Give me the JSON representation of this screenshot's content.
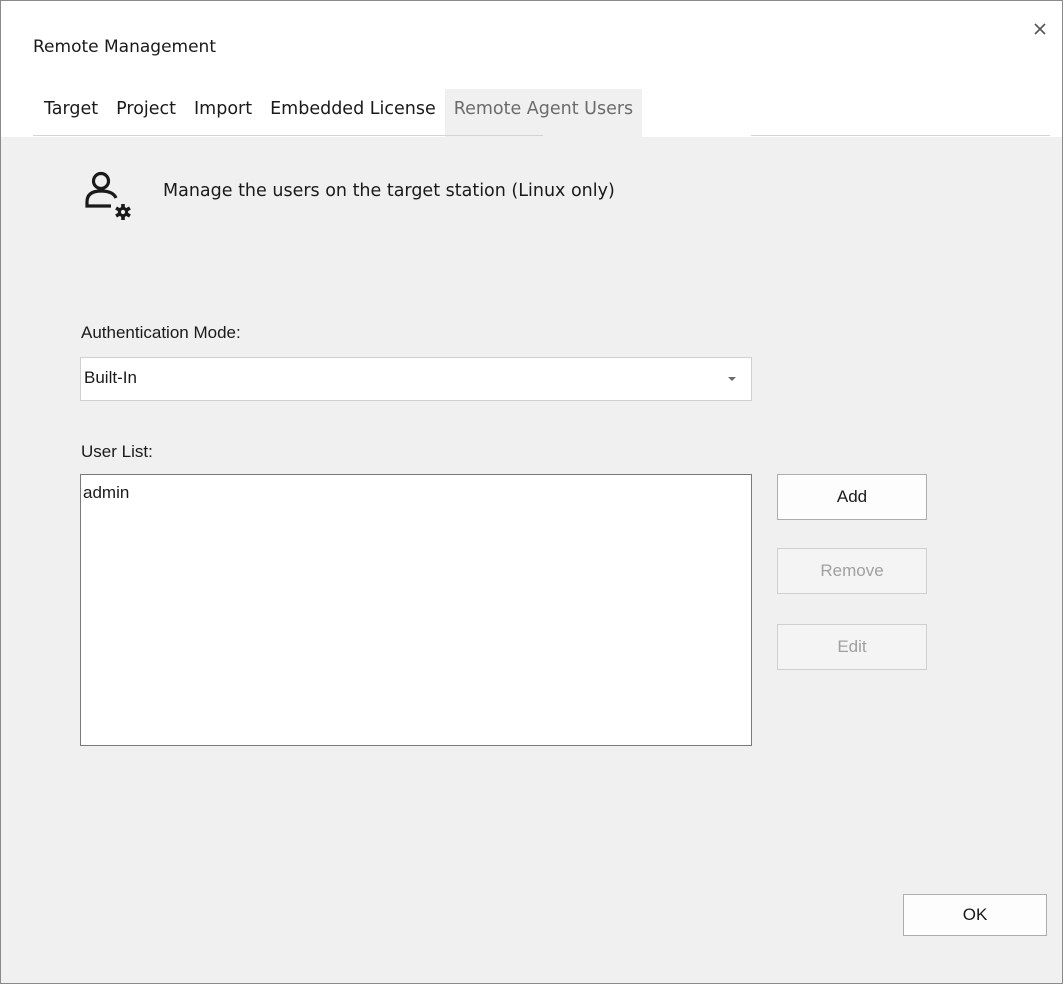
{
  "window": {
    "title": "Remote Management"
  },
  "tabs": [
    {
      "label": "Target"
    },
    {
      "label": "Project"
    },
    {
      "label": "Import"
    },
    {
      "label": "Embedded License"
    },
    {
      "label": "Remote Agent Users",
      "active": true
    }
  ],
  "header": {
    "icon": "user-gear-icon",
    "text": "Manage the users on the target station (Linux only)"
  },
  "auth": {
    "label": "Authentication Mode:",
    "value": "Built-In"
  },
  "users": {
    "label": "User List:",
    "items": [
      "admin"
    ]
  },
  "buttons": {
    "add": "Add",
    "remove": "Remove",
    "edit": "Edit",
    "ok": "OK"
  },
  "colors": {
    "window_bg": "#f0f0f0",
    "disabled_text": "#a0a0a0",
    "active_tab_text": "#6b6b6b"
  }
}
